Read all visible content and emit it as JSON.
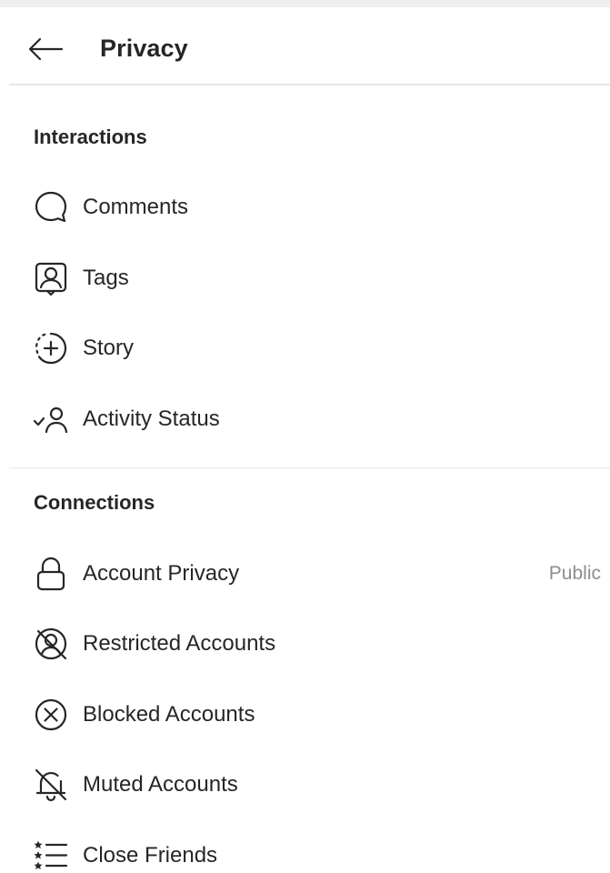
{
  "header": {
    "title": "Privacy",
    "back_icon": "back-arrow-icon"
  },
  "sections": {
    "interactions": {
      "title": "Interactions",
      "items": [
        {
          "label": "Comments",
          "icon": "comment-bubble-icon"
        },
        {
          "label": "Tags",
          "icon": "tag-person-icon"
        },
        {
          "label": "Story",
          "icon": "story-add-icon"
        },
        {
          "label": "Activity Status",
          "icon": "activity-status-icon"
        }
      ]
    },
    "connections": {
      "title": "Connections",
      "items": [
        {
          "label": "Account Privacy",
          "value": "Public",
          "icon": "lock-icon"
        },
        {
          "label": "Restricted Accounts",
          "icon": "restricted-icon"
        },
        {
          "label": "Blocked Accounts",
          "icon": "blocked-icon"
        },
        {
          "label": "Muted Accounts",
          "icon": "muted-bell-icon"
        },
        {
          "label": "Close Friends",
          "icon": "close-friends-list-icon"
        }
      ]
    }
  },
  "colors": {
    "text": "#262626",
    "secondary_text": "#8e8e8e",
    "divider": "#e8e8e8",
    "status_strip": "#efefef"
  }
}
